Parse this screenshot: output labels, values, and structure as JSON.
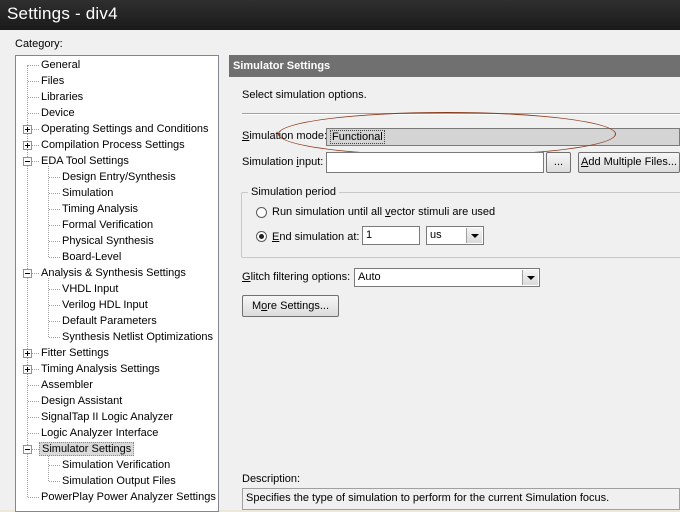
{
  "window": {
    "title": "Settings - div4"
  },
  "category": {
    "label": "Category:",
    "items": [
      {
        "label": "General",
        "level": 0
      },
      {
        "label": "Files",
        "level": 0
      },
      {
        "label": "Libraries",
        "level": 0
      },
      {
        "label": "Device",
        "level": 0
      },
      {
        "label": "Operating Settings and Conditions",
        "level": 0,
        "expander": "plus"
      },
      {
        "label": "Compilation Process Settings",
        "level": 0,
        "expander": "plus"
      },
      {
        "label": "EDA Tool Settings",
        "level": 0,
        "expander": "minus"
      },
      {
        "label": "Design Entry/Synthesis",
        "level": 1
      },
      {
        "label": "Simulation",
        "level": 1
      },
      {
        "label": "Timing Analysis",
        "level": 1
      },
      {
        "label": "Formal Verification",
        "level": 1
      },
      {
        "label": "Physical Synthesis",
        "level": 1
      },
      {
        "label": "Board-Level",
        "level": 1
      },
      {
        "label": "Analysis & Synthesis Settings",
        "level": 0,
        "expander": "minus"
      },
      {
        "label": "VHDL Input",
        "level": 1
      },
      {
        "label": "Verilog HDL Input",
        "level": 1
      },
      {
        "label": "Default Parameters",
        "level": 1
      },
      {
        "label": "Synthesis Netlist Optimizations",
        "level": 1
      },
      {
        "label": "Fitter Settings",
        "level": 0,
        "expander": "plus"
      },
      {
        "label": "Timing Analysis Settings",
        "level": 0,
        "expander": "plus"
      },
      {
        "label": "Assembler",
        "level": 0
      },
      {
        "label": "Design Assistant",
        "level": 0
      },
      {
        "label": "SignalTap II Logic Analyzer",
        "level": 0
      },
      {
        "label": "Logic Analyzer Interface",
        "level": 0
      },
      {
        "label": "Simulator Settings",
        "level": 0,
        "expander": "minus",
        "selected": true
      },
      {
        "label": "Simulation Verification",
        "level": 1
      },
      {
        "label": "Simulation Output Files",
        "level": 1
      },
      {
        "label": "PowerPlay Power Analyzer Settings",
        "level": 0
      }
    ]
  },
  "panel": {
    "header": "Simulator Settings",
    "intro": "Select simulation options.",
    "mode": {
      "label_first": "S",
      "label_rest": "imulation mode:",
      "value": "Functional"
    },
    "input": {
      "label_pre": "Simulation ",
      "label_u": "i",
      "label_post": "nput:",
      "value": "",
      "browse_label": "...",
      "add_label_u": "A",
      "add_label_rest": "dd Multiple Files..."
    },
    "period": {
      "title": "Simulation period",
      "option_run_pre": "Run simulation until all ",
      "option_run_u": "v",
      "option_run_post": "ector stimuli are used",
      "option_end_u": "E",
      "option_end_rest": "nd simulation at:",
      "end_value": "1",
      "unit": "us",
      "selected": "end"
    },
    "glitch": {
      "label_u": "G",
      "label_rest": "litch filtering options:",
      "value": "Auto"
    },
    "more_label_pre": "M",
    "more_label_u": "o",
    "more_label_post": "re Settings...",
    "description": {
      "label": "Description:",
      "text": "Specifies the type of simulation to perform for the current Simulation focus."
    }
  },
  "colors": {
    "title_bg": "#1a1a1a",
    "panel_header_bg": "#707070",
    "annotation": "#8b3a1a"
  }
}
